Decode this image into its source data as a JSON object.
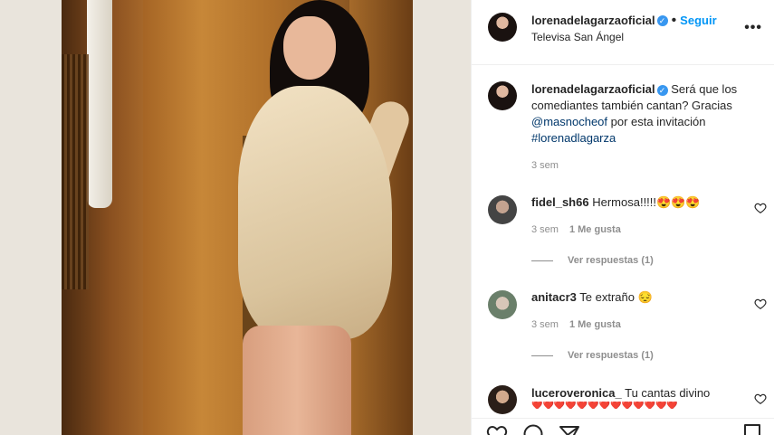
{
  "post": {
    "username": "lorenadelagarzaoficial",
    "follow_label": "Seguir",
    "location": "Televisa San Ángel",
    "more_label": "•••"
  },
  "caption": {
    "username": "lorenadelagarzaoficial",
    "text_1": "Será que los comediantes también cantan? Gracias",
    "mention": "@masnocheof",
    "text_2": "por esta invitación",
    "hashtag": "#lorenadlagarza",
    "time": "3 sem"
  },
  "comments": [
    {
      "username": "fidel_sh66",
      "text": "Hermosa!!!!!",
      "emoji": "😍😍😍",
      "time": "3 sem",
      "likes": "1 Me gusta",
      "replies": "Ver respuestas (1)"
    },
    {
      "username": "anitacr3",
      "text": "Te extraño",
      "emoji": "😔",
      "time": "3 sem",
      "likes": "1 Me gusta",
      "replies": "Ver respuestas (1)"
    },
    {
      "username": "luceroveronica_",
      "text": "Tu cantas divino",
      "emoji": "❤️❤️❤️❤️❤️❤️❤️❤️❤️❤️❤️❤️❤️"
    }
  ],
  "colors": {
    "link": "#0095f6",
    "mention": "#00376b",
    "muted": "#8e8e8e"
  }
}
